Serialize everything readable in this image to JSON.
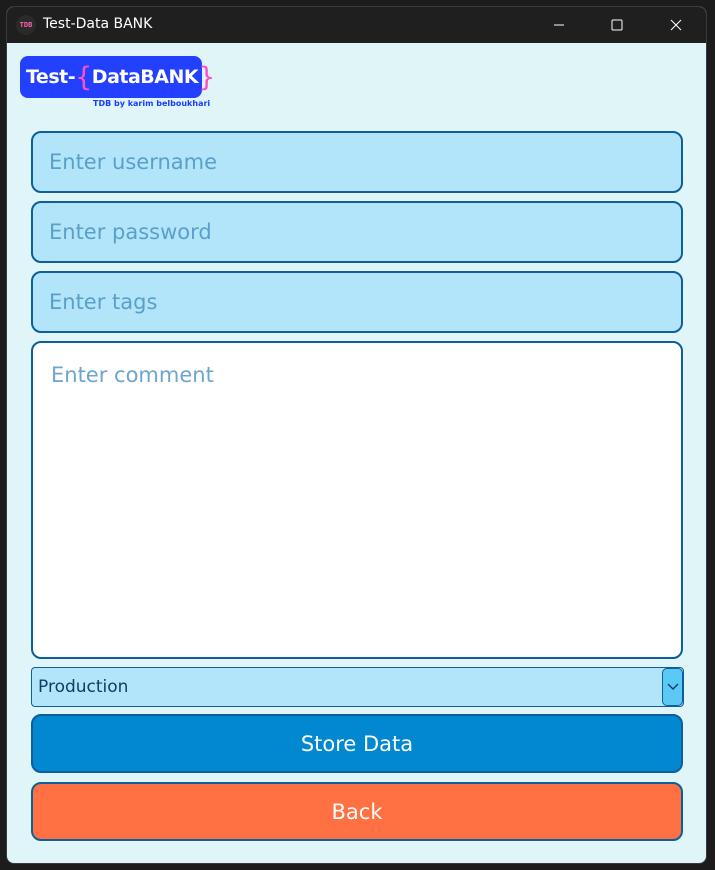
{
  "window": {
    "title": "Test-Data BANK",
    "icon_text": "TDB",
    "controls": [
      "minimize-icon",
      "maximize-icon",
      "close-icon"
    ]
  },
  "logo": {
    "prefix": "Test-",
    "open_brace": "{",
    "name": "DataBANK",
    "close_brace": "}",
    "subtitle": "TDB by karim belboukhari"
  },
  "form": {
    "username_placeholder": "Enter username",
    "password_placeholder": "Enter password",
    "tags_placeholder": "Enter tags",
    "comment_placeholder": "Enter comment",
    "environment": {
      "selected": "Production"
    },
    "store_label": "Store Data",
    "back_label": "Back"
  },
  "colors": {
    "background": "#dff5f8",
    "field_bg": "#b3e5fa",
    "border": "#0d5e9a",
    "store_button": "#0288d1",
    "back_button": "#ff7043",
    "logo_bg": "#2340ff",
    "logo_brace": "#ff4fc8"
  }
}
